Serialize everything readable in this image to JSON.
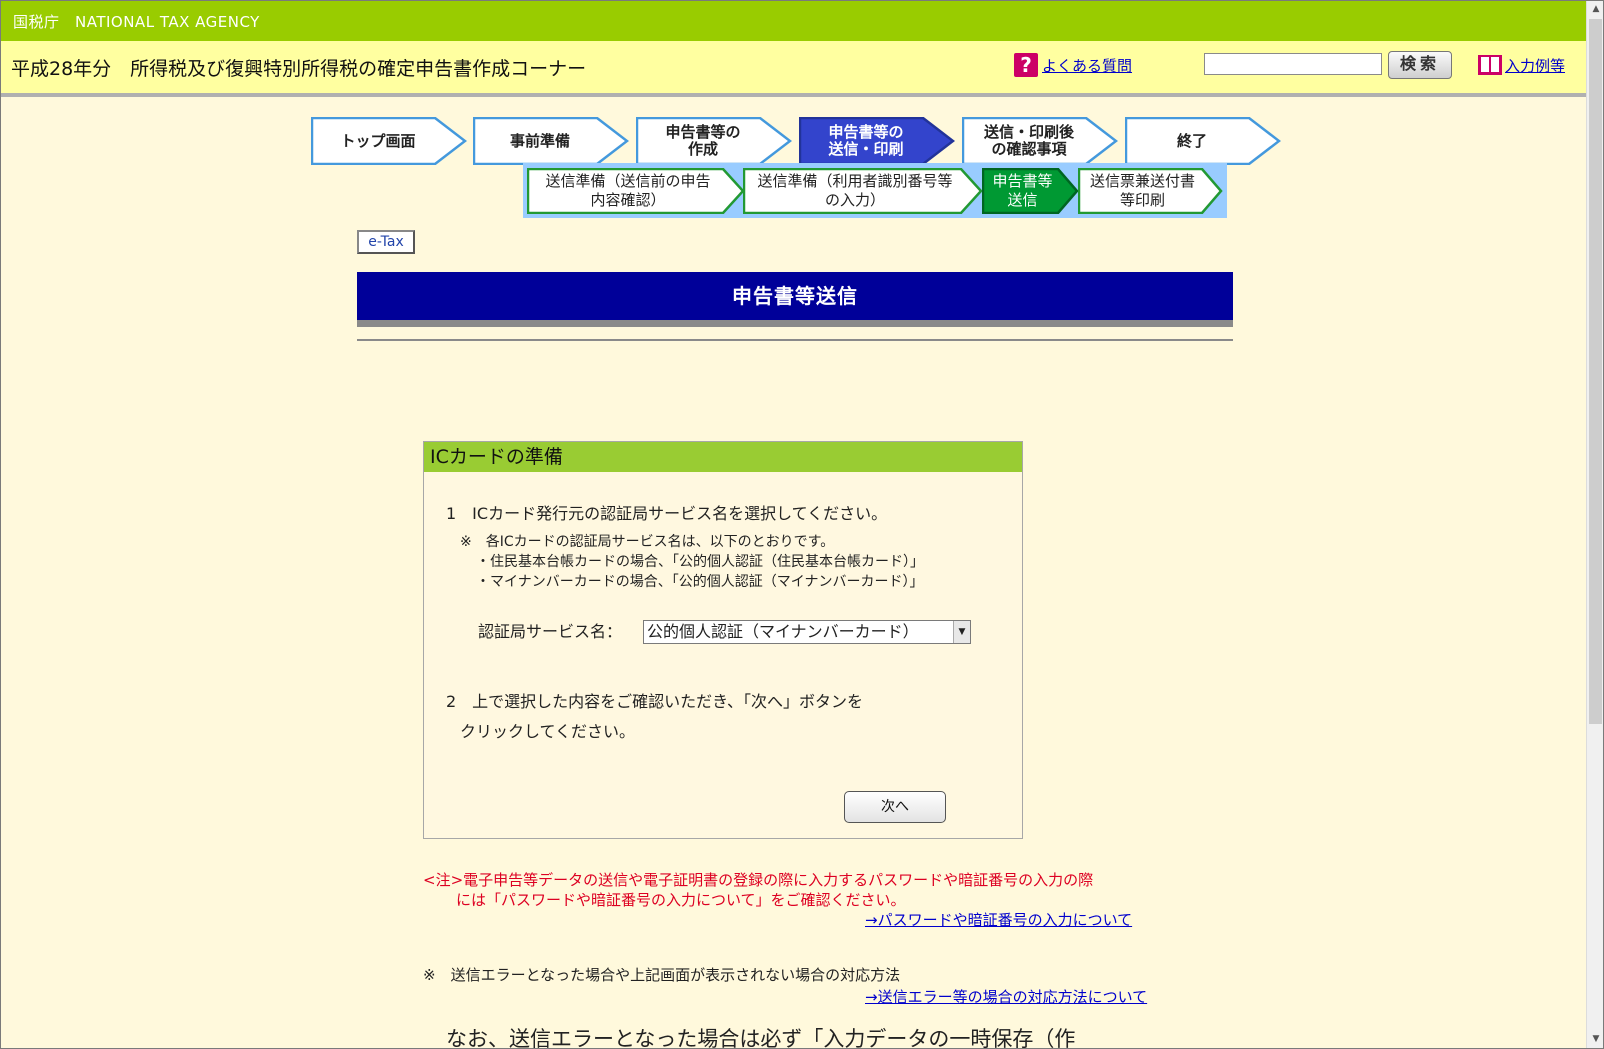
{
  "agency_bar": {
    "text": "国税庁　NATIONAL TAX AGENCY"
  },
  "header": {
    "title": "平成28年分　所得税及び復興特別所得税の確定申告書作成コーナー",
    "faq_icon": "?",
    "faq_label": "よくある質問",
    "search_value": "",
    "search_button": "検索",
    "examples_label": "入力例等"
  },
  "steps": [
    {
      "label": "トップ画面",
      "state": "inactive"
    },
    {
      "label": "事前準備",
      "state": "inactive"
    },
    {
      "label": "申告書等の\n作成",
      "state": "inactive"
    },
    {
      "label": "申告書等の\n送信・印刷",
      "state": "active"
    },
    {
      "label": "送信・印刷後\nの確認事項",
      "state": "inactive"
    },
    {
      "label": "終了",
      "state": "inactive"
    }
  ],
  "sub_steps": [
    {
      "label": "送信準備（送信前の申告\n内容確認）",
      "state": "inactive"
    },
    {
      "label": "送信準備（利用者識別番号等\nの入力）",
      "state": "inactive"
    },
    {
      "label": "申告書等\n送信",
      "state": "active"
    },
    {
      "label": "送信票兼送付書\n等印刷",
      "state": "inactive"
    }
  ],
  "etax_badge": "e-Tax",
  "section_title": "申告書等送信",
  "panel": {
    "header": "ICカードの準備",
    "step1": "1　ICカード発行元の認証局サービス名を選択してください。",
    "note_line1": "※　各ICカードの認証局サービス名は、以下のとおりです。",
    "note_line2": "・住民基本台帳カードの場合、「公的個人認証（住民基本台帳カード）」",
    "note_line3": "・マイナンバーカードの場合、「公的個人認証（マイナンバーカード）」",
    "service_label": "認証局サービス名：",
    "service_selected": "公的個人認証（マイナンバーカード）",
    "step2_line1": "2　上で選択した内容をご確認いただき、「次へ」ボタンを",
    "step2_line2": "クリックしてください。",
    "next_button": "次へ"
  },
  "warning_line1": "<注>電子申告等データの送信や電子証明書の登録の際に入力するパスワードや暗証番号の入力の際",
  "warning_line2": "には「パスワードや暗証番号の入力について」をご確認ください。",
  "password_link": "→パスワードや暗証番号の入力について",
  "error_note": "※　送信エラーとなった場合や上記画面が表示されない場合の対応方法",
  "error_link": "→送信エラー等の場合の対応方法について",
  "bottom_text": "なお、送信エラーとなった場合は必ず「入力データの一時保存（作",
  "colors": {
    "agency_green": "#99cc00",
    "header_yellow": "#ffffa0",
    "page_bg": "#fff9dc",
    "step_active": "#3344cc",
    "substep_active": "#009933",
    "banner_navy": "#000099",
    "panel_green": "#99cc33",
    "warning_red": "#dd0022",
    "link_blue": "#0000cc"
  }
}
